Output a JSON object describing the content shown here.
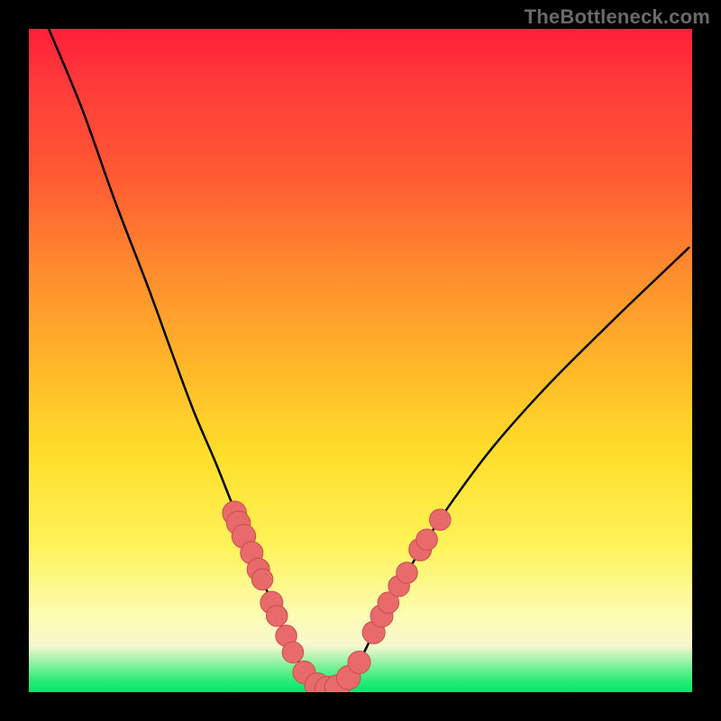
{
  "watermark": {
    "text": "TheBottleneck.com"
  },
  "colors": {
    "background": "#000000",
    "curve": "#000000",
    "marker_fill": "#e86a6a",
    "marker_stroke": "#c74f4f",
    "green": "#00e56a",
    "red": "#ff1f3a",
    "yellow": "#ffde2a"
  },
  "chart_data": {
    "type": "line",
    "title": "",
    "xlabel": "",
    "ylabel": "",
    "xlim": [
      0,
      100
    ],
    "ylim": [
      0,
      100
    ],
    "series": [
      {
        "name": "bottleneck-curve",
        "x": [
          3,
          8,
          13,
          18,
          22,
          25,
          28,
          30,
          32,
          34,
          36,
          38,
          39.5,
          41,
          42,
          43,
          44,
          45,
          46,
          47,
          48,
          50,
          52,
          54,
          57,
          60,
          64,
          70,
          78,
          88,
          99.5
        ],
        "y": [
          100,
          88,
          74,
          61,
          50,
          42,
          35,
          30,
          25,
          20,
          15,
          10,
          7,
          4,
          2.2,
          1.2,
          0.6,
          0.4,
          0.6,
          1.2,
          2.2,
          5,
          9,
          13,
          18,
          23,
          29,
          37,
          46,
          56,
          67
        ]
      }
    ],
    "markers": [
      {
        "name": "left-cluster",
        "x": 31.0,
        "y": 27.0,
        "r": 1.8
      },
      {
        "name": "left-cluster",
        "x": 31.6,
        "y": 25.5,
        "r": 1.8
      },
      {
        "name": "left-cluster",
        "x": 32.4,
        "y": 23.5,
        "r": 1.8
      },
      {
        "name": "left-cluster",
        "x": 33.6,
        "y": 21.0,
        "r": 1.7
      },
      {
        "name": "left-cluster",
        "x": 34.6,
        "y": 18.5,
        "r": 1.7
      },
      {
        "name": "left-cluster",
        "x": 35.2,
        "y": 17.0,
        "r": 1.6
      },
      {
        "name": "left-cluster",
        "x": 36.6,
        "y": 13.5,
        "r": 1.7
      },
      {
        "name": "left-cluster",
        "x": 37.4,
        "y": 11.5,
        "r": 1.6
      },
      {
        "name": "left-cluster",
        "x": 38.8,
        "y": 8.5,
        "r": 1.6
      },
      {
        "name": "left-cluster",
        "x": 39.8,
        "y": 6.0,
        "r": 1.6
      },
      {
        "name": "bottom-cluster",
        "x": 41.5,
        "y": 3.0,
        "r": 1.7
      },
      {
        "name": "bottom-cluster",
        "x": 43.5,
        "y": 1.0,
        "r": 1.9
      },
      {
        "name": "bottom-cluster",
        "x": 45.0,
        "y": 0.5,
        "r": 1.9
      },
      {
        "name": "bottom-cluster",
        "x": 46.5,
        "y": 0.7,
        "r": 1.9
      },
      {
        "name": "bottom-cluster",
        "x": 48.2,
        "y": 2.2,
        "r": 1.8
      },
      {
        "name": "bottom-cluster",
        "x": 49.8,
        "y": 4.5,
        "r": 1.7
      },
      {
        "name": "right-cluster",
        "x": 52.0,
        "y": 9.0,
        "r": 1.7
      },
      {
        "name": "right-cluster",
        "x": 53.2,
        "y": 11.5,
        "r": 1.7
      },
      {
        "name": "right-cluster",
        "x": 54.2,
        "y": 13.5,
        "r": 1.6
      },
      {
        "name": "right-cluster",
        "x": 55.8,
        "y": 16.0,
        "r": 1.6
      },
      {
        "name": "right-cluster",
        "x": 57.0,
        "y": 18.0,
        "r": 1.6
      },
      {
        "name": "right-cluster",
        "x": 59.0,
        "y": 21.5,
        "r": 1.7
      },
      {
        "name": "right-cluster",
        "x": 60.0,
        "y": 23.0,
        "r": 1.6
      },
      {
        "name": "right-cluster",
        "x": 62.0,
        "y": 26.0,
        "r": 1.6
      }
    ]
  }
}
